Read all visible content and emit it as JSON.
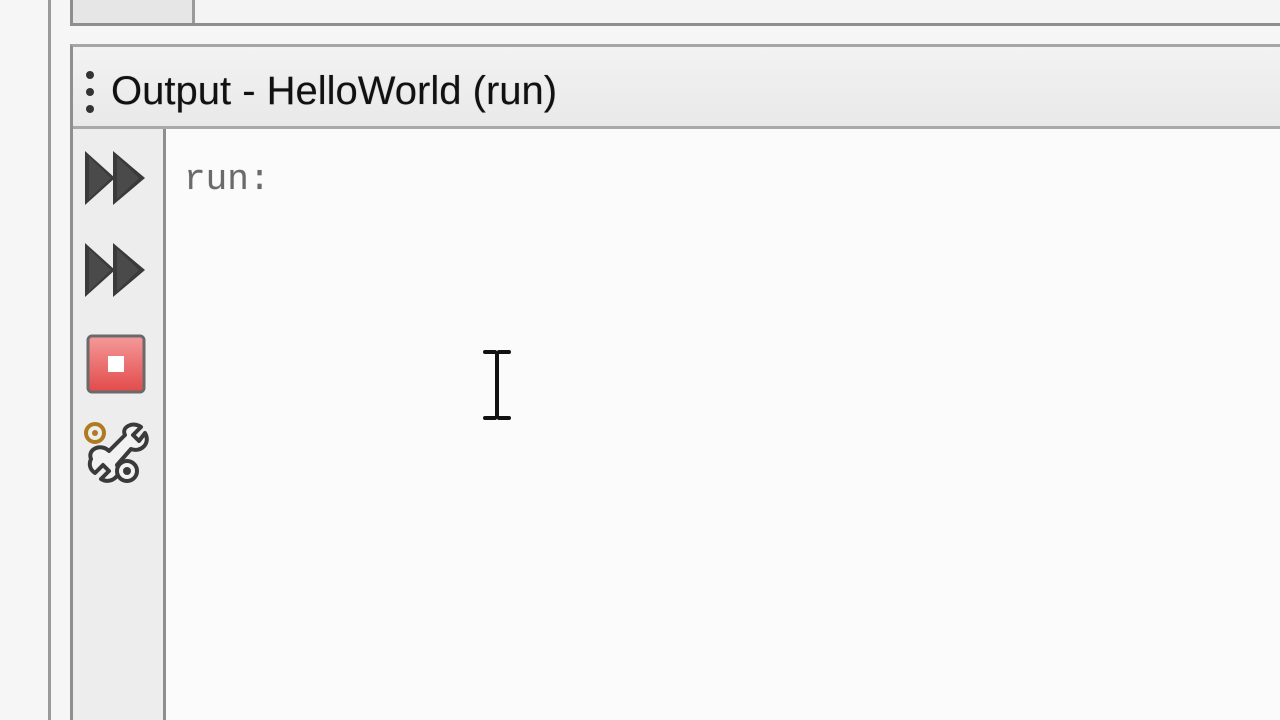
{
  "panel": {
    "title": "Output - HelloWorld (run)"
  },
  "toolbar": {
    "items": [
      {
        "name": "rerun",
        "icon": "fast-forward-icon"
      },
      {
        "name": "rerun-with-different-parameters",
        "icon": "fast-forward-icon"
      },
      {
        "name": "stop",
        "icon": "stop-icon",
        "color": "#e24a4a"
      },
      {
        "name": "settings",
        "icon": "wrench-gear-icon"
      }
    ]
  },
  "console": {
    "lines": [
      "run:"
    ]
  },
  "colors": {
    "stop_red": "#e24a4a",
    "icon_dark": "#3a3a3a"
  }
}
